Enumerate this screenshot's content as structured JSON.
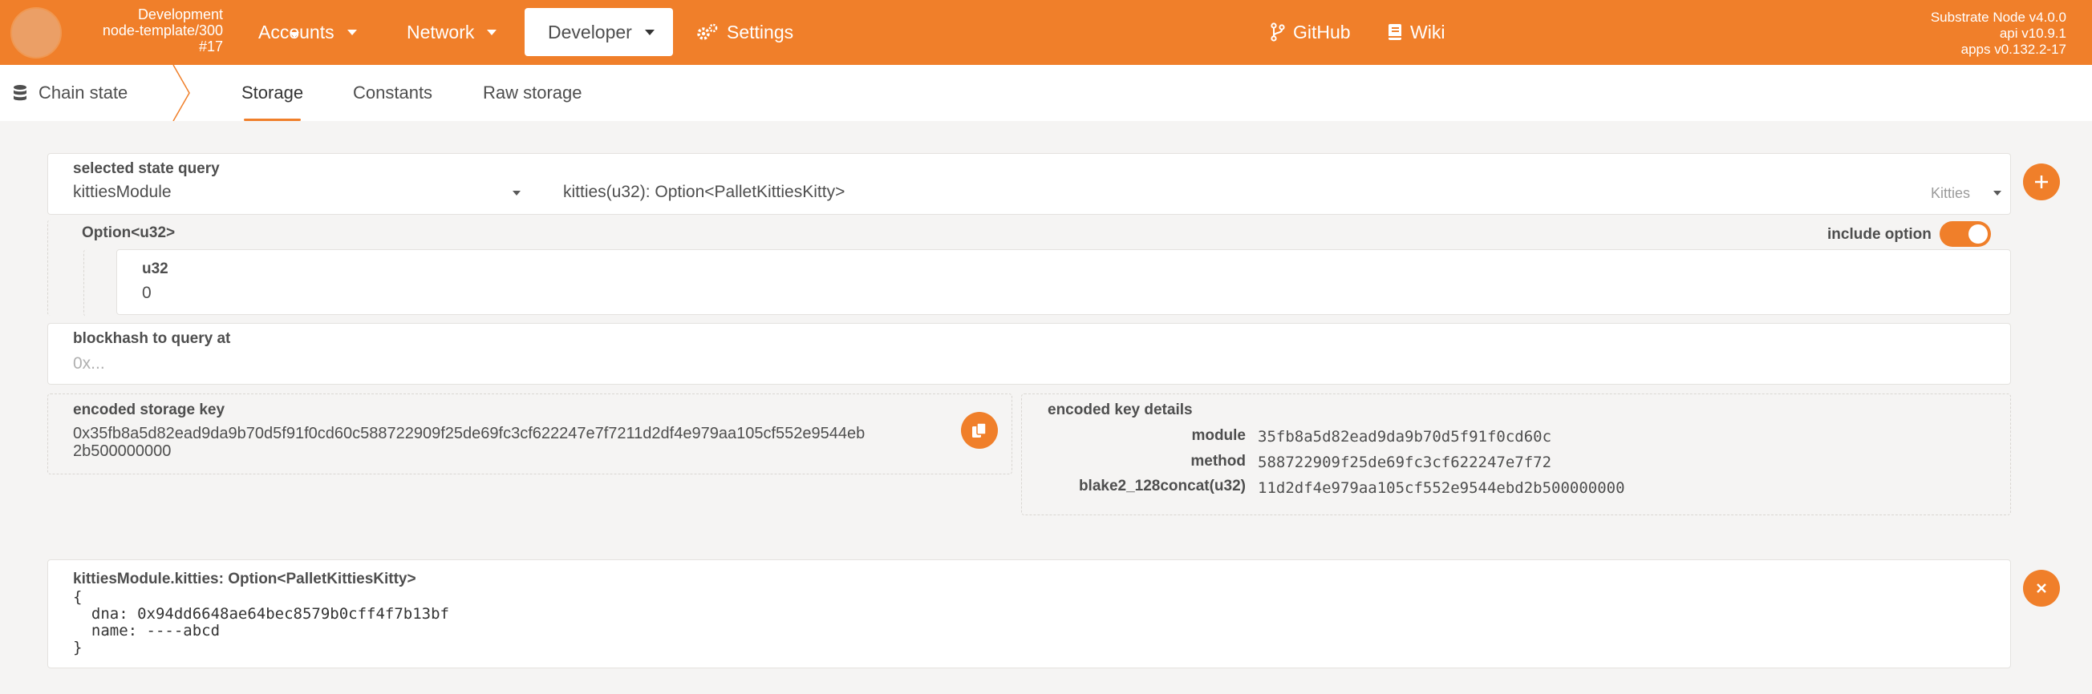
{
  "topbar": {
    "chain_name": "Development",
    "chain_node": "node-template/300",
    "chain_block": "#17",
    "nav": {
      "accounts": "Accounts",
      "network": "Network",
      "developer": "Developer",
      "settings": "Settings",
      "github": "GitHub",
      "wiki": "Wiki"
    },
    "info": {
      "node": "Substrate Node v4.0.0",
      "api": "api v10.9.1",
      "apps": "apps v0.132.2-17"
    }
  },
  "subnav": {
    "section": "Chain state",
    "tabs": [
      "Storage",
      "Constants",
      "Raw storage"
    ],
    "active_tab": "Storage"
  },
  "query": {
    "label": "selected state query",
    "module": "kittiesModule",
    "method": "kitties(u32): Option<PalletKittiesKitty>",
    "method_doc": "Kitties"
  },
  "option": {
    "label": "Option<u32>",
    "include_label": "include option",
    "include_on": true,
    "u32_label": "u32",
    "u32_value": "0"
  },
  "blockhash": {
    "label": "blockhash to query at",
    "placeholder": "0x..."
  },
  "encoded": {
    "label": "encoded storage key",
    "line1": "0x35fb8a5d82ead9da9b70d5f91f0cd60c588722909f25de69fc3cf622247e7f7211d2df4e979aa105cf552e9544eb",
    "line2": "2b500000000"
  },
  "key_details": {
    "label": "encoded key details",
    "rows": [
      {
        "key": "module",
        "value": "35fb8a5d82ead9da9b70d5f91f0cd60c"
      },
      {
        "key": "method",
        "value": "588722909f25de69fc3cf622247e7f72"
      },
      {
        "key": "blake2_128concat(u32)",
        "value": "11d2df4e979aa105cf552e9544ebd2b500000000"
      }
    ]
  },
  "result": {
    "title": "kittiesModule.kitties: Option<PalletKittiesKitty>",
    "open": "{",
    "lines": [
      "  dna: 0x94dd6648ae64bec8579b0cff4f7b13bf",
      "  name: ----abcd"
    ],
    "close": "}"
  },
  "colors": {
    "accent": "#f07f2a",
    "background": "#f5f4f3"
  }
}
